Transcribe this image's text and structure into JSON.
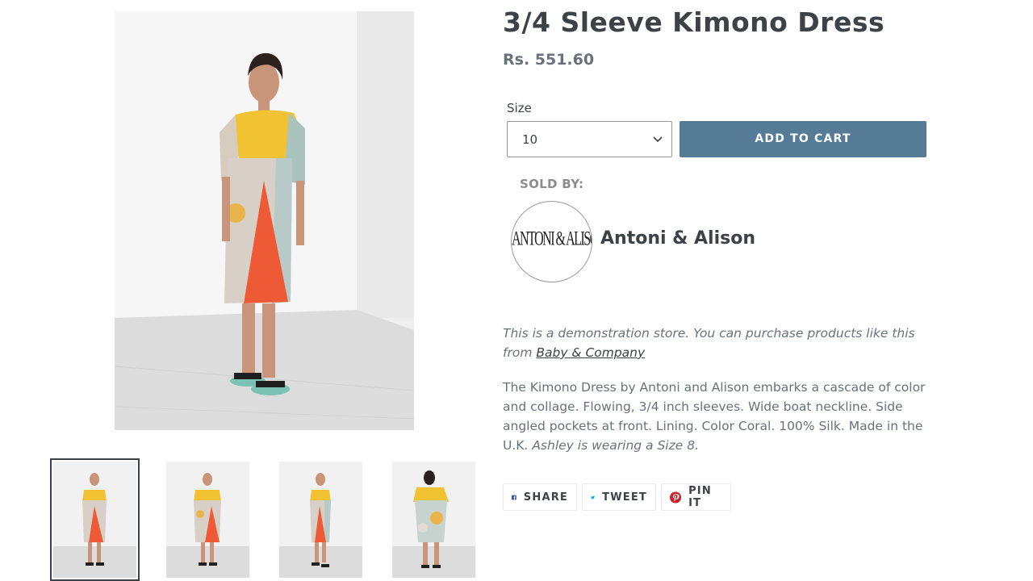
{
  "product": {
    "title": "3/4 Sleeve Kimono Dress",
    "price": "Rs. 551.60",
    "main_image_alt": "",
    "thumbnails": [
      {
        "view": "front",
        "selected": true
      },
      {
        "view": "front-alt",
        "selected": false
      },
      {
        "view": "side",
        "selected": false
      },
      {
        "view": "back",
        "selected": false
      }
    ]
  },
  "size": {
    "label": "Size",
    "selected": "10",
    "icon": "chevron-down-icon"
  },
  "cart": {
    "add_label": "ADD TO CART",
    "button_color": "#557b97"
  },
  "vendor": {
    "sold_by_label": "SOLD BY:",
    "logo_text": "ANTONI & ALISON",
    "name": "Antoni & Alison"
  },
  "note": {
    "text": "This is a demonstration store. You can purchase products like this from",
    "link_text": "Baby & Company"
  },
  "description": {
    "text": "The Kimono Dress by Antoni and Alison embarks a cascade of color and collage. Flowing, 3/4 inch sleeves. Wide boat neckline. Side angled pockets at front. Lining. Color Coral. 100% Silk. Made in the U.K.",
    "model_note": "Ashley is wearing a Size 8."
  },
  "share": {
    "facebook_label": "SHARE",
    "twitter_label": "TWEET",
    "pinterest_label": "PIN IT",
    "facebook_color": "#3b5998",
    "twitter_color": "#00aced",
    "pinterest_color": "#cb2027"
  }
}
